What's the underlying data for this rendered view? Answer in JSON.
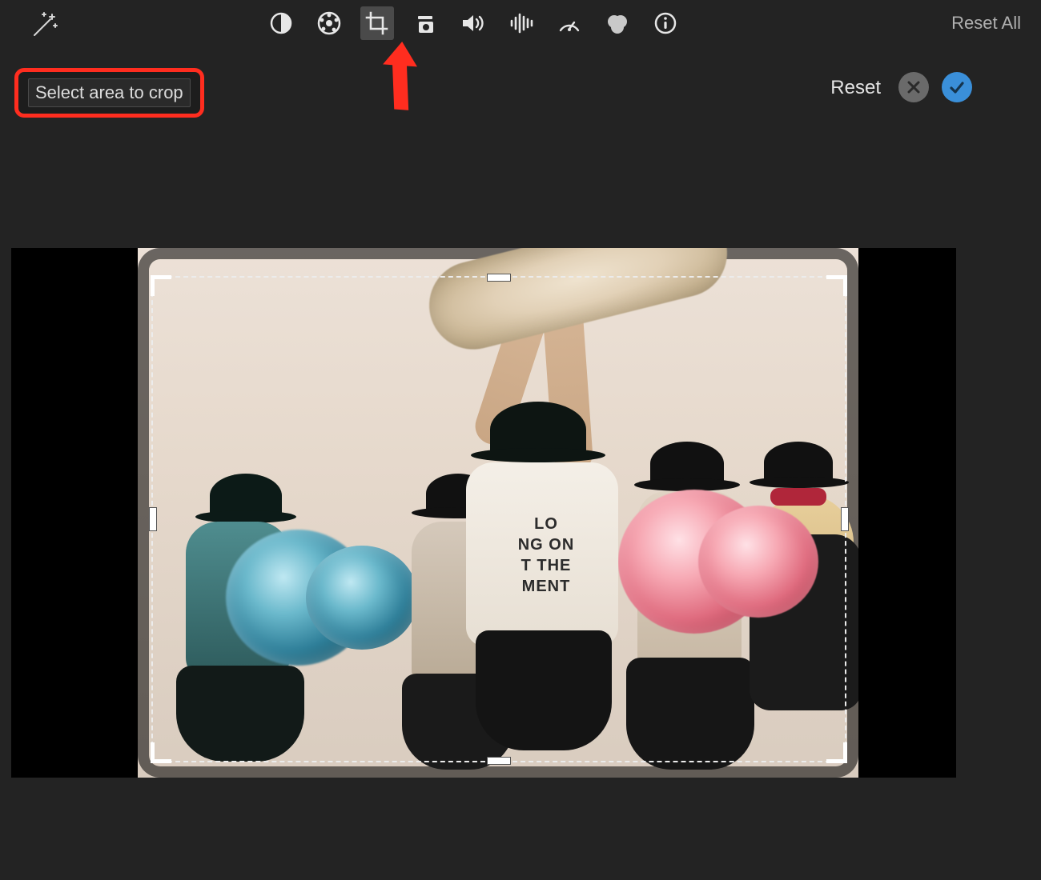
{
  "toolbar": {
    "reset_all_label": "Reset All",
    "icons": {
      "wand": "magic-wand-icon",
      "contrast": "color-correction-icon",
      "palette": "color-balance-icon",
      "crop": "crop-icon",
      "video": "stabilization-icon",
      "volume": "volume-icon",
      "noise": "noise-reduction-icon",
      "speed": "speed-icon",
      "filters": "color-filter-icon",
      "info": "clip-info-icon"
    },
    "selected": "crop"
  },
  "crop_bar": {
    "instruction": "Select area to crop",
    "reset_label": "Reset"
  },
  "preview": {
    "tee_lines": [
      "LO",
      "NG ON",
      "T THE",
      "MENT"
    ]
  },
  "annotations": {
    "highlight_instruction": true,
    "arrow_points_to": "crop-icon"
  }
}
